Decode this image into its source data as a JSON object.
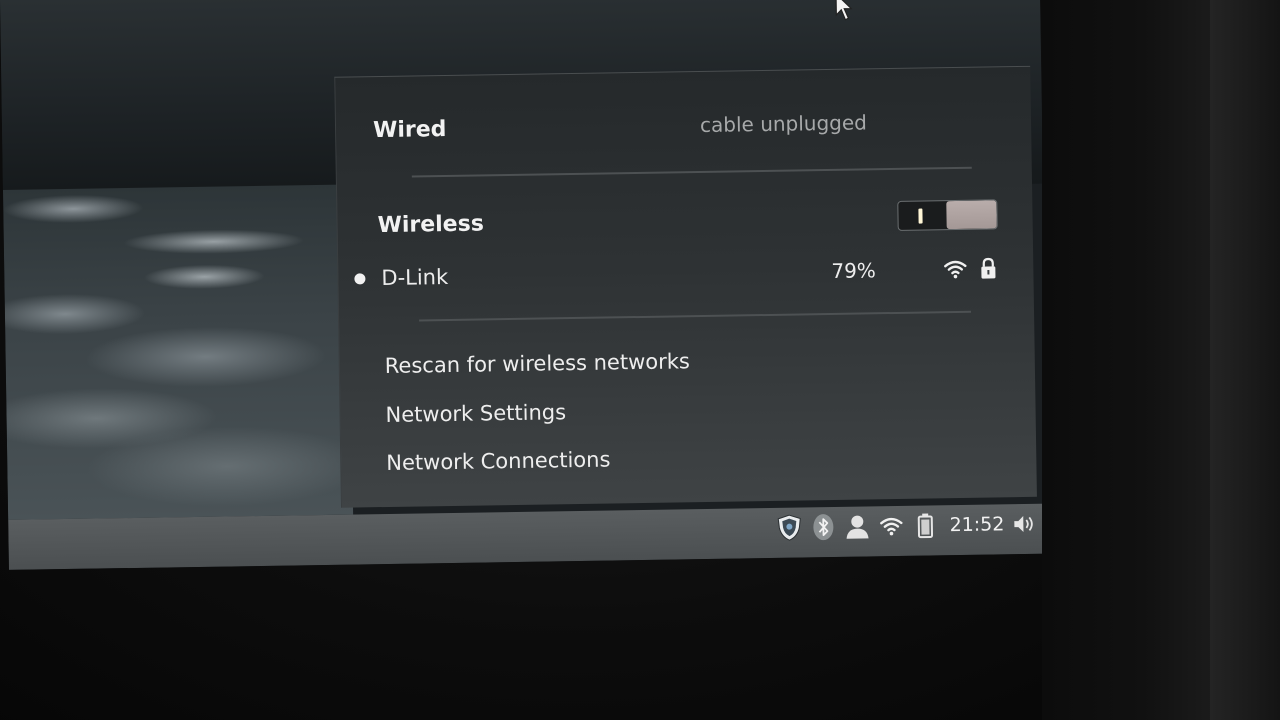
{
  "wired": {
    "title": "Wired",
    "status": "cable unplugged"
  },
  "wireless": {
    "title": "Wireless",
    "toggle_state": "on",
    "networks": [
      {
        "name": "D-Link",
        "strength": "79%",
        "connected": true,
        "secured": true,
        "signal_icon": "wifi-signal-icon",
        "security_icon": "lock-icon"
      }
    ]
  },
  "menu": {
    "rescan": "Rescan for wireless networks",
    "settings": "Network Settings",
    "connections": "Network Connections"
  },
  "taskbar": {
    "clock": "21:52",
    "tray_icons": [
      "shield-icon",
      "bluetooth-icon",
      "user-icon",
      "wifi-icon",
      "battery-icon",
      "volume-icon"
    ]
  },
  "colors": {
    "panel_bg": "#2e3234",
    "text": "#eeeeee",
    "muted_text": "#a7a9aa",
    "toggle_knob": "#b0a4a2"
  }
}
